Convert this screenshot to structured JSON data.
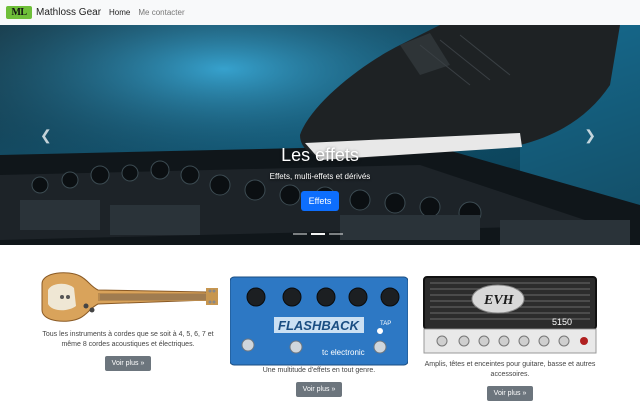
{
  "navbar": {
    "logo_text": "ML",
    "brand": "Mathloss Gear",
    "links": [
      "Home",
      "Me contacter"
    ]
  },
  "carousel": {
    "title": "Les effets",
    "subtitle": "Effets, multi-effets et dérivés",
    "button_label": "Effets",
    "prev_icon": "chevron-left-icon",
    "next_icon": "chevron-right-icon",
    "indicator_count": 3,
    "active_indicator": 2
  },
  "products": [
    {
      "image": "electric-guitar",
      "description": "Tous les instruments à cordes que se soit à 4, 5, 6, 7 et même 8 cordes acoustiques et électriques.",
      "button_label": "Voir plus »"
    },
    {
      "image": "flashback-delay-pedal",
      "description": "Une multitude d'effets en tout genre.",
      "button_label": "Voir plus »"
    },
    {
      "image": "evh-5150-amp-head",
      "description": "Amplis, têtes et enceintes pour guitare, basse et autres accessoires.",
      "button_label": "Voir plus »"
    }
  ],
  "colors": {
    "primary": "#0d6efd",
    "secondary": "#6c757d",
    "navbar_bg": "#f8f9fa",
    "logo_green": "#6fbf3a"
  }
}
